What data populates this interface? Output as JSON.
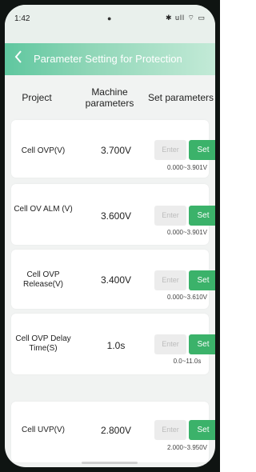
{
  "status": {
    "time": "1:42",
    "center_icon": "camera-dot-icon",
    "icons": "✱ ull ⌔ ▭"
  },
  "header": {
    "back_icon": "chevron-left-icon",
    "title": "Parameter Setting for Protection"
  },
  "columns": {
    "project": "Project",
    "machine": "Machine parameters",
    "set": "Set parameters"
  },
  "rows": [
    {
      "label": "Cell OVP(V)",
      "value": "3.700V",
      "enter_placeholder": "Enter",
      "set_label": "Set",
      "range": "0.000~3.901V"
    },
    {
      "label": "Cell OV ALM (V)",
      "value": "3.600V",
      "enter_placeholder": "Enter",
      "set_label": "Set",
      "range": "0.000~3.901V"
    },
    {
      "label": "Cell OVP Release(V)",
      "value": "3.400V",
      "enter_placeholder": "Enter",
      "set_label": "Set",
      "range": "0.000~3.610V"
    },
    {
      "label": "Cell OVP Delay Time(S)",
      "value": "1.0s",
      "enter_placeholder": "Enter",
      "set_label": "Set",
      "range": "0.0~11.0s"
    },
    {
      "label": "Cell UVP(V)",
      "value": "2.800V",
      "enter_placeholder": "Enter",
      "set_label": "Set",
      "range": "2.000~3.950V"
    }
  ],
  "colors": {
    "accent": "#3bb26a",
    "header_start": "#5fc79f",
    "header_end": "#c3ead7"
  }
}
